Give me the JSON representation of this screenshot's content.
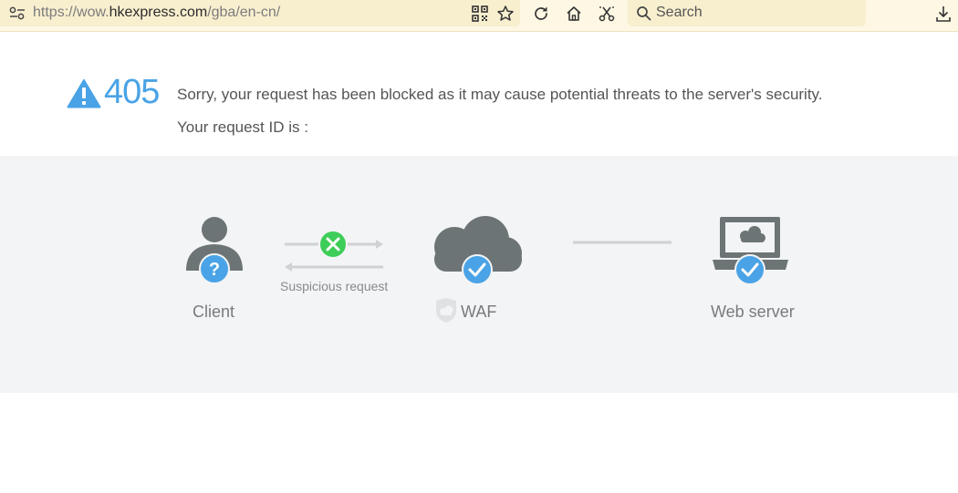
{
  "browser": {
    "url_prefix": "https://wow.",
    "url_host": "hkexpress.com",
    "url_path": "/gba/en-cn/",
    "search_placeholder": "Search"
  },
  "error": {
    "code": "405",
    "message": "Sorry, your request has been blocked as it may cause potential threats to the server's security.",
    "request_id_label": "Your request ID is :"
  },
  "diagram": {
    "client_label": "Client",
    "arrow_label": "Suspicious request",
    "waf_label": "WAF",
    "server_label": "Web server"
  },
  "colors": {
    "accent_blue": "#4aa3e6",
    "block_green": "#3dcd58",
    "icon_gray": "#6d7475"
  }
}
